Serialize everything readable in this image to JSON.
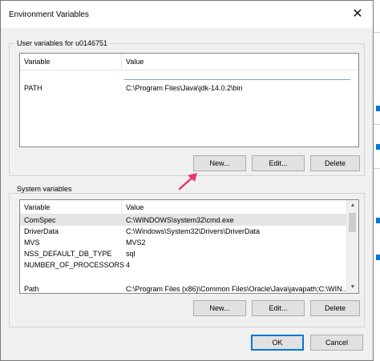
{
  "window": {
    "title": "Environment Variables",
    "close_glyph": "✕"
  },
  "user_vars": {
    "group_label": "User variables for u0146751",
    "headers": [
      "Variable",
      "Value"
    ],
    "rows": [
      {
        "variable": "PATH",
        "value": "C:\\Program Files\\Java\\jdk-14.0.2\\bin"
      }
    ],
    "buttons": {
      "new": "New...",
      "edit": "Edit...",
      "delete": "Delete"
    }
  },
  "system_vars": {
    "group_label": "System variables",
    "headers": [
      "Variable",
      "Value"
    ],
    "rows": [
      {
        "variable": "ComSpec",
        "value": "C:\\WINDOWS\\system32\\cmd.exe"
      },
      {
        "variable": "DriverData",
        "value": "C:\\Windows\\System32\\Drivers\\DriverData"
      },
      {
        "variable": "MVS",
        "value": "MVS2"
      },
      {
        "variable": "NSS_DEFAULT_DB_TYPE",
        "value": "sql"
      },
      {
        "variable": "NUMBER_OF_PROCESSORS",
        "value": "4"
      },
      {
        "variable": "",
        "value": ""
      },
      {
        "variable": "Path",
        "value": "C:\\Program Files (x86)\\Common Files\\Oracle\\Java\\javapath;C:\\WIN..."
      }
    ],
    "buttons": {
      "new": "New...",
      "edit": "Edit...",
      "delete": "Delete"
    }
  },
  "footer": {
    "ok": "OK",
    "cancel": "Cancel"
  },
  "colors": {
    "accent": "#0078d7",
    "annotation_arrow": "#e8356e"
  },
  "icons": {
    "annotation": "pointer-arrow-icon",
    "scroll_up": "scroll-up-icon",
    "scroll_down": "scroll-down-icon"
  }
}
